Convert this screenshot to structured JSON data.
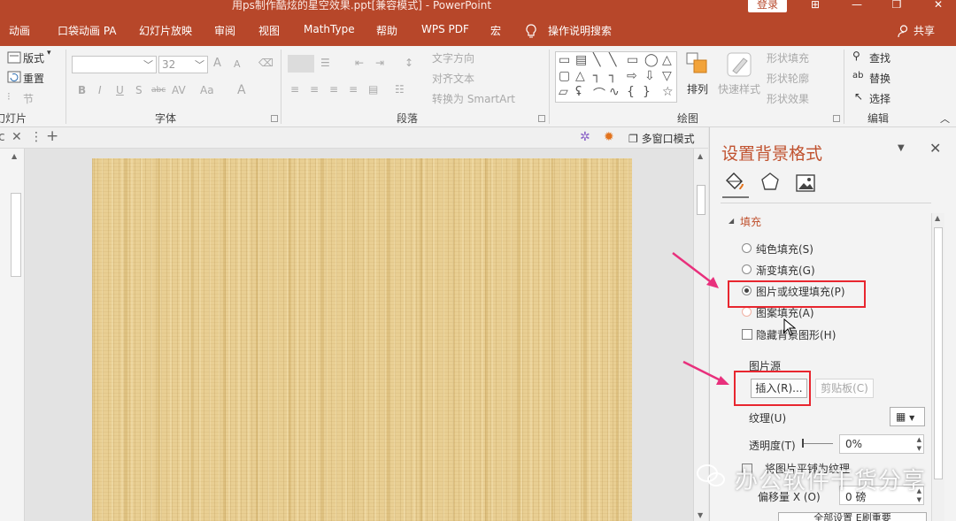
{
  "window": {
    "title": "用ps制作酷炫的星空效果.ppt[兼容模式] - PowerPoint",
    "login": "登录",
    "buttons": [
      "⊞",
      "—",
      "❐",
      "✕"
    ]
  },
  "menu": {
    "tabs": [
      "动画",
      "口袋动画 PA",
      "幻灯片放映",
      "审阅",
      "视图",
      "MathType",
      "帮助",
      "WPS PDF",
      "宏",
      "操作说明搜索"
    ],
    "share": "共享"
  },
  "ribbon": {
    "slides": {
      "layout": "版式",
      "reset": "重置",
      "section": "节",
      "label": "幻灯片"
    },
    "font": {
      "size": "32",
      "grow": "A",
      "shrink": "A",
      "bold": "B",
      "italic": "I",
      "underline": "U",
      "shadow": "S",
      "strike": "abc",
      "spacing": "AV",
      "case": "Aa",
      "color": "A",
      "label": "字体"
    },
    "paragraph": {
      "direction": "文字方向",
      "align": "对齐文本",
      "smartart": "转换为 SmartArt",
      "label": "段落"
    },
    "drawing": {
      "arrange": "排列",
      "quickstyle": "快速样式",
      "fill": "形状填充",
      "outline": "形状轮廓",
      "effects": "形状效果",
      "label": "绘图"
    },
    "editing": {
      "find": "查找",
      "replace": "替换",
      "select": "选择",
      "label": "编辑"
    }
  },
  "doc": {
    "multiwindow": "多窗口模式"
  },
  "pane": {
    "title": "设置背景格式",
    "fill_section": "填充",
    "options": [
      {
        "label": "纯色填充(S)",
        "selected": false
      },
      {
        "label": "渐变填充(G)",
        "selected": false
      },
      {
        "label": "图片或纹理填充(P)",
        "selected": true
      },
      {
        "label": "图案填充(A)",
        "selected": false
      }
    ],
    "hide_bg": "隐藏背景图形(H)",
    "picture_source": "图片源",
    "insert": "插入(R)...",
    "clipboard": "剪贴板(C)",
    "texture": "纹理(U)",
    "transparency_label": "透明度(T)",
    "transparency_value": "0%",
    "tile": "将图片平铺为纹理",
    "offset_x_label": "偏移量 X (O)",
    "offset_x_value": "0 磅",
    "bottom_btn": "全部设置    E刷重要"
  },
  "watermark": "办公软件干货分享",
  "colors": {
    "accent": "#b7472a",
    "highlight": "#e8262f",
    "arrow": "#e8307c"
  }
}
